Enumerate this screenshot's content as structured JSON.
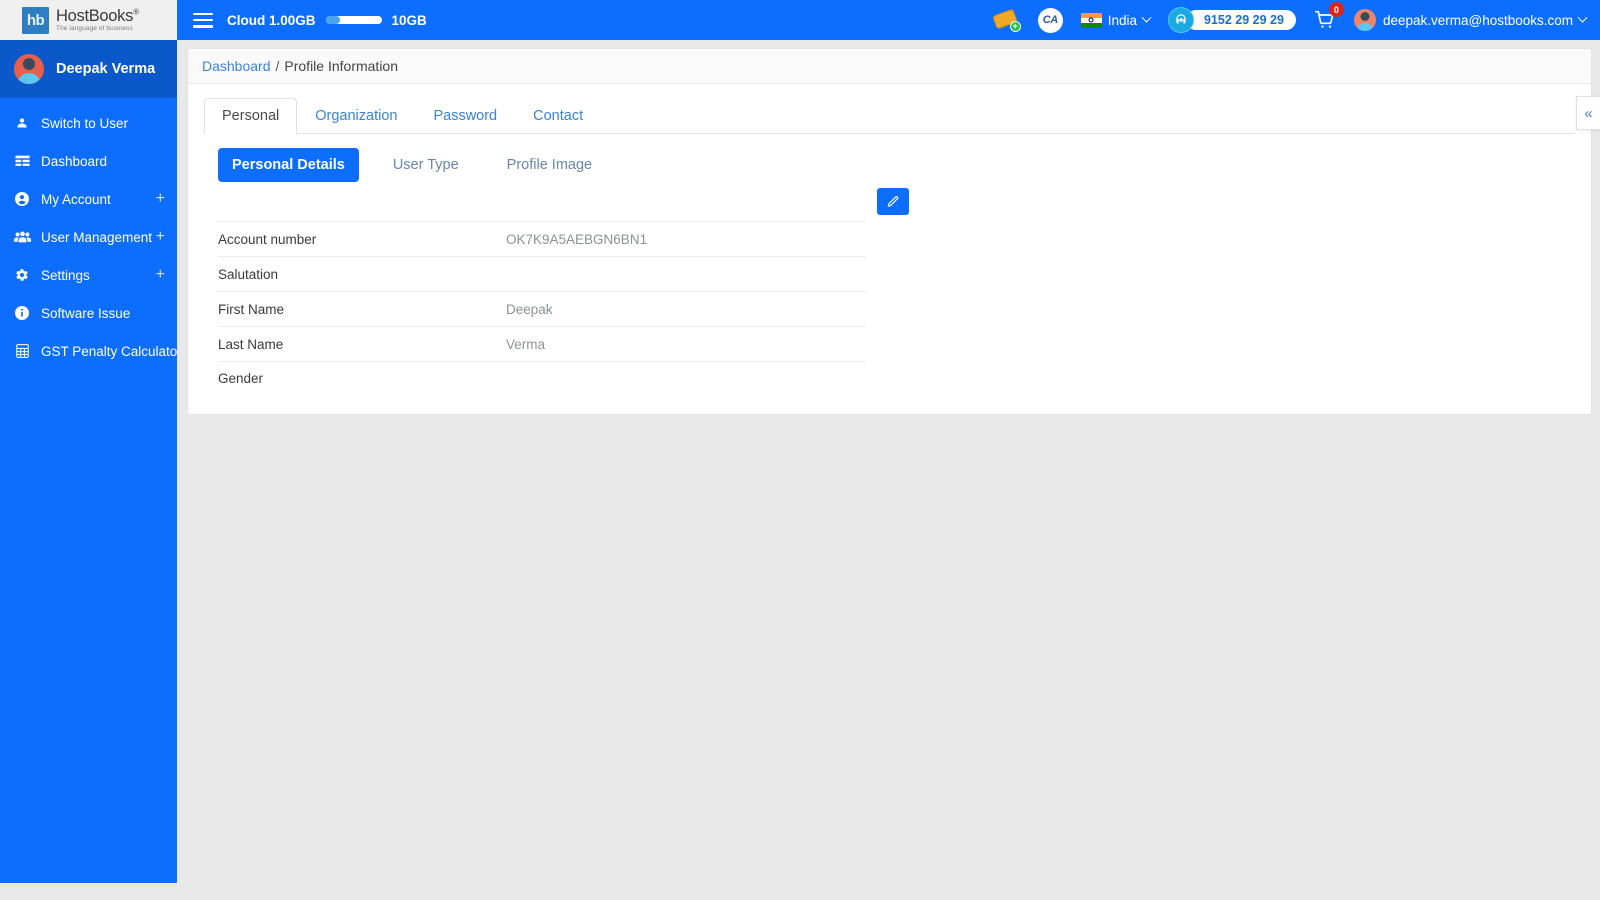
{
  "brand": {
    "logo_mark": "hb",
    "name": "HostBooks",
    "registered": "®",
    "tagline": "The language of business"
  },
  "topbar": {
    "menu_icon": "hamburger-icon",
    "cloud_label": "Cloud 1.00GB",
    "cloud_used_gb": 1.0,
    "cloud_total_label": "10GB",
    "cloud_total_gb": 10,
    "cloud_percent": 25,
    "ticket_icon": "add-ticket-icon",
    "ca_badge": "CA",
    "country": "India",
    "country_flag": "india-flag-icon",
    "support_phone": "9152 29 29 29",
    "support_icon": "headset-icon",
    "cart_icon": "shopping-cart-icon",
    "cart_count": "0",
    "user_email": "deepak.verma@hostbooks.com",
    "user_avatar": "user-avatar-icon"
  },
  "sidebar": {
    "profile_name": "Deepak Verma",
    "profile_avatar": "user-avatar-icon",
    "items": [
      {
        "label": "Switch to User",
        "icon": "user-icon",
        "expandable": false
      },
      {
        "label": "Dashboard",
        "icon": "dashboard-icon",
        "expandable": false
      },
      {
        "label": "My Account",
        "icon": "account-circle-icon",
        "expandable": true,
        "expand": "+"
      },
      {
        "label": "User Management",
        "icon": "users-group-icon",
        "expandable": true,
        "expand": "+"
      },
      {
        "label": "Settings",
        "icon": "gear-icon",
        "expandable": true,
        "expand": "+"
      },
      {
        "label": "Software Issue",
        "icon": "info-icon",
        "expandable": false
      },
      {
        "label": "GST Penalty Calculator",
        "icon": "calculator-icon",
        "expandable": false
      }
    ]
  },
  "breadcrumb": {
    "root": "Dashboard",
    "separator": "/",
    "current": "Profile Information"
  },
  "tabs": [
    {
      "label": "Personal",
      "active": true
    },
    {
      "label": "Organization",
      "active": false
    },
    {
      "label": "Password",
      "active": false
    },
    {
      "label": "Contact",
      "active": false
    }
  ],
  "subtabs": [
    {
      "label": "Personal Details",
      "active": true
    },
    {
      "label": "User Type",
      "active": false
    },
    {
      "label": "Profile Image",
      "active": false
    }
  ],
  "edit_button": {
    "icon": "pencil-edit-icon",
    "title": "Edit"
  },
  "details": [
    {
      "label": "Account number",
      "value": "OK7K9A5AEBGN6BN1"
    },
    {
      "label": "Salutation",
      "value": ""
    },
    {
      "label": "First Name",
      "value": "Deepak"
    },
    {
      "label": "Last Name",
      "value": "Verma"
    },
    {
      "label": "Gender",
      "value": ""
    }
  ],
  "collapse_handle": {
    "icon": "double-chevron-left-icon",
    "glyph": "«"
  },
  "colors": {
    "primary_blue": "#0d6efd",
    "sidebar_profile_blue": "#0a58ca",
    "link_blue": "#3a84d6",
    "page_bg": "#e8e8e8",
    "badge_red": "#e2231a",
    "support_cyan": "#1aa9e3",
    "avatar_orange": "#e8604c"
  }
}
